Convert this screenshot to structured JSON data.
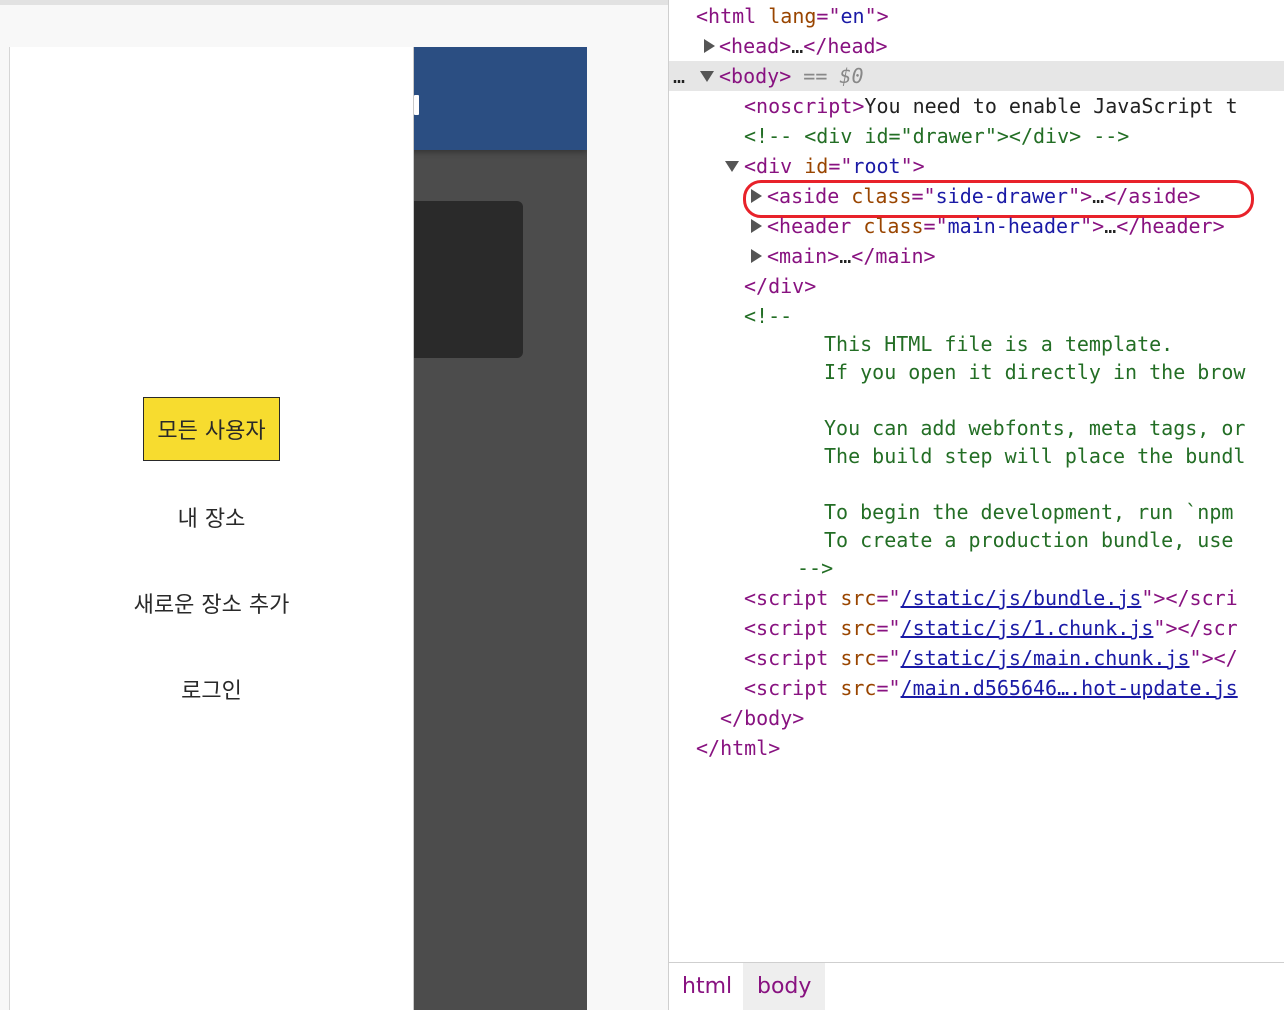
{
  "preview": {
    "nav_items": [
      {
        "label": "모든 사용자",
        "active": true
      },
      {
        "label": "내 장소",
        "active": false
      },
      {
        "label": "새로운 장소 추가",
        "active": false
      },
      {
        "label": "로그인",
        "active": false
      }
    ]
  },
  "devtools": {
    "lines": {
      "l0": [
        "<html ",
        "lang",
        "=\"",
        "en",
        "\">"
      ],
      "l1": [
        "<head>",
        "…",
        "</head>"
      ],
      "l2_dots": "…",
      "l2": [
        "<body>",
        " == ",
        "$0"
      ],
      "l3": [
        "<noscript>",
        "You need to enable JavaScript t"
      ],
      "l4": "<!-- <div id=\"drawer\"></div> -->",
      "l5": [
        "<div ",
        "id",
        "=\"",
        "root",
        "\">"
      ],
      "l6": [
        "<aside ",
        "class",
        "=\"",
        "side-drawer",
        "\">",
        "…",
        "</aside>"
      ],
      "l7": [
        "<header ",
        "class",
        "=\"",
        "main-header",
        "\">",
        "…",
        "</header>"
      ],
      "l8": [
        "<main>",
        "…",
        "</main>"
      ],
      "l9": "</div>",
      "l10": "<!--",
      "c1": "This HTML file is a template.",
      "c2": "If you open it directly in the brow",
      "c3": "You can add webfonts, meta tags, or",
      "c4": "The build step will place the bundl",
      "c5": "To begin the development, run `npm",
      "c6": "To create a production bundle, use",
      "c7": "-->",
      "s1": [
        "<script ",
        "src",
        "=\"",
        "/static/js/bundle.js",
        "\"></scri"
      ],
      "s2": [
        "<script ",
        "src",
        "=\"",
        "/static/js/1.chunk.js",
        "\"></scr"
      ],
      "s3": [
        "<script ",
        "src",
        "=\"",
        "/static/js/main.chunk.js",
        "\"></"
      ],
      "s4": [
        "<script ",
        "src",
        "=\"",
        "/main.d565646….hot-update.js",
        ""
      ],
      "end_body": "</body>",
      "end_html": "</html>"
    },
    "breadcrumbs": [
      "html",
      "body"
    ]
  },
  "colors": {
    "header_blue": "#2b4e82",
    "active_nav": "#f7dc2f",
    "highlight_red": "#e8222a"
  }
}
